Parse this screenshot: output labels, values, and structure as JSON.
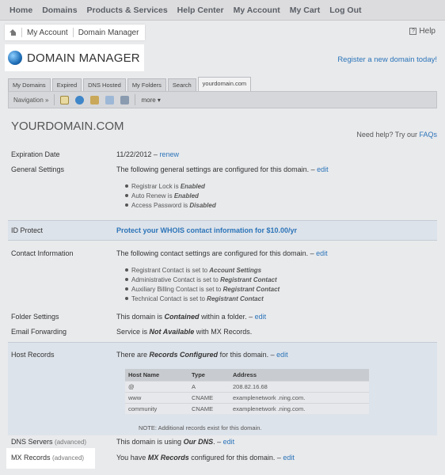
{
  "topnav": [
    "Home",
    "Domains",
    "Products & Services",
    "Help Center",
    "My Account",
    "My Cart",
    "Log Out"
  ],
  "breadcrumb": {
    "account": "My Account",
    "current": "Domain Manager"
  },
  "help": "Help",
  "title": "DOMAIN MANAGER",
  "register_link": "Register a new domain today!",
  "tabs": [
    "My Domains",
    "Expired",
    "DNS Hosted",
    "My Folders",
    "Search",
    "yourdomain.com"
  ],
  "toolbar": {
    "navigation": "Navigation »",
    "more": "more ▾"
  },
  "domain": "YOURDOMAIN.COM",
  "faq": {
    "prefix": "Need help? Try our",
    "link": "FAQs"
  },
  "expiration": {
    "label": "Expiration Date",
    "date": "11/22/2012",
    "sep": "–",
    "renew": "renew"
  },
  "general": {
    "label": "General Settings",
    "text": "The following general settings are configured for this domain. –",
    "edit": "edit",
    "items": [
      {
        "name": "Registrar Lock is",
        "value": "Enabled"
      },
      {
        "name": "Auto Renew is",
        "value": "Enabled"
      },
      {
        "name": "Access Password is",
        "value": "Disabled"
      }
    ]
  },
  "idprotect": {
    "label": "ID Protect",
    "link": "Protect your WHOIS contact information for $10.00/yr"
  },
  "contact": {
    "label": "Contact Information",
    "text": "The following contact settings are configured for this domain. –",
    "edit": "edit",
    "items": [
      {
        "name": "Registrant Contact is set to",
        "value": "Account Settings"
      },
      {
        "name": "Administrative Contact is set to",
        "value": "Registrant Contact"
      },
      {
        "name": "Auxiliary Billing Contact is set to",
        "value": "Registrant Contact"
      },
      {
        "name": "Technical Contact is set to",
        "value": "Registrant Contact"
      }
    ]
  },
  "folder": {
    "label": "Folder Settings",
    "text": "This domain is",
    "value": "Contained",
    "text2": "within a folder. –",
    "edit": "edit"
  },
  "email": {
    "label": "Email Forwarding",
    "text": "Service is",
    "value": "Not Available",
    "text2": "with MX Records."
  },
  "host": {
    "label": "Host Records",
    "text": "There are",
    "value": "Records Configured",
    "text2": "for this domain. –",
    "edit": "edit",
    "columns": [
      "Host Name",
      "Type",
      "Address"
    ],
    "rows": [
      [
        "@",
        "A",
        "208.82.16.68"
      ],
      [
        "www",
        "CNAME",
        "examplenetwork .ning.com."
      ],
      [
        "community",
        "CNAME",
        "examplenetwork .ning.com."
      ]
    ],
    "note": "NOTE: Additional records exist for this domain."
  },
  "dns": {
    "label": "DNS Servers",
    "adv": "(advanced)",
    "text": "This domain is using",
    "value": "Our DNS",
    "text2": ". –",
    "edit": "edit"
  },
  "mx": {
    "label": "MX Records",
    "adv": "(advanced)",
    "text": "You have",
    "value": "MX Records",
    "text2": "configured for this domain. –",
    "edit": "edit"
  },
  "colors": {
    "link": "#2b74b9",
    "band": "#dde3ea",
    "background": "#e9eaec"
  }
}
